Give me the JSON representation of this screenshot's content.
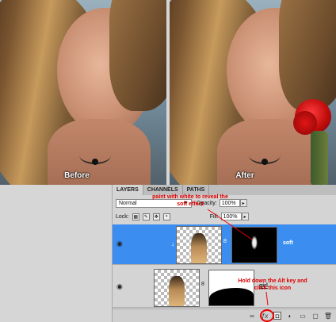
{
  "captions": {
    "before": "Before",
    "after": "After"
  },
  "panel": {
    "tabs": [
      "LAYERS",
      "CHANNELS",
      "PATHS"
    ],
    "blend_mode": "Normal",
    "opacity_label": "Opacity:",
    "opacity_value": "100%",
    "lock_label": "Lock:",
    "fill_label": "Fill:",
    "fill_value": "100%",
    "layers": [
      {
        "name": "soft",
        "selected": true
      },
      {
        "name": "girl",
        "selected": false
      }
    ],
    "bottom_icons": [
      "link-icon",
      "fx-icon",
      "layer-mask-icon",
      "adjustment-icon",
      "folder-icon",
      "new-layer-icon",
      "trash-icon"
    ]
  },
  "annotations": {
    "top": "paint with white to reveal the soft effect",
    "bottom": "Hold down the Alt key and click this icon"
  },
  "colors": {
    "selected_layer": "#3b8ef0",
    "annotation": "#e00000"
  }
}
